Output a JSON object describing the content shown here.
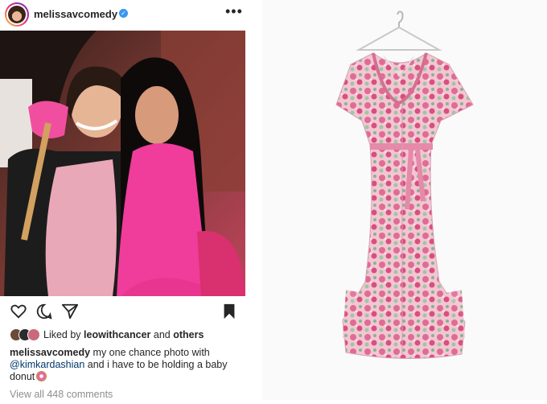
{
  "post": {
    "username": "melissavcomedy",
    "more_label": "•••",
    "liked": {
      "prefix": "Liked by ",
      "user": "leowithcancer",
      "middle": " and ",
      "others": "others"
    },
    "caption": {
      "user": "melissavcomedy",
      "text_1": " my one chance photo with ",
      "mention": "@kimkardashian",
      "text_2": " and i have to be holding a baby donut"
    },
    "comments_label": "View all 448 comments"
  },
  "colors": {
    "verified": "#3897f0",
    "mention": "#00376b",
    "muted": "#8e8e8e",
    "dress_pink": "#e07aa0"
  },
  "icons": [
    "heart-icon",
    "comment-icon",
    "share-icon",
    "bookmark-icon",
    "verified-icon",
    "more-icon"
  ]
}
